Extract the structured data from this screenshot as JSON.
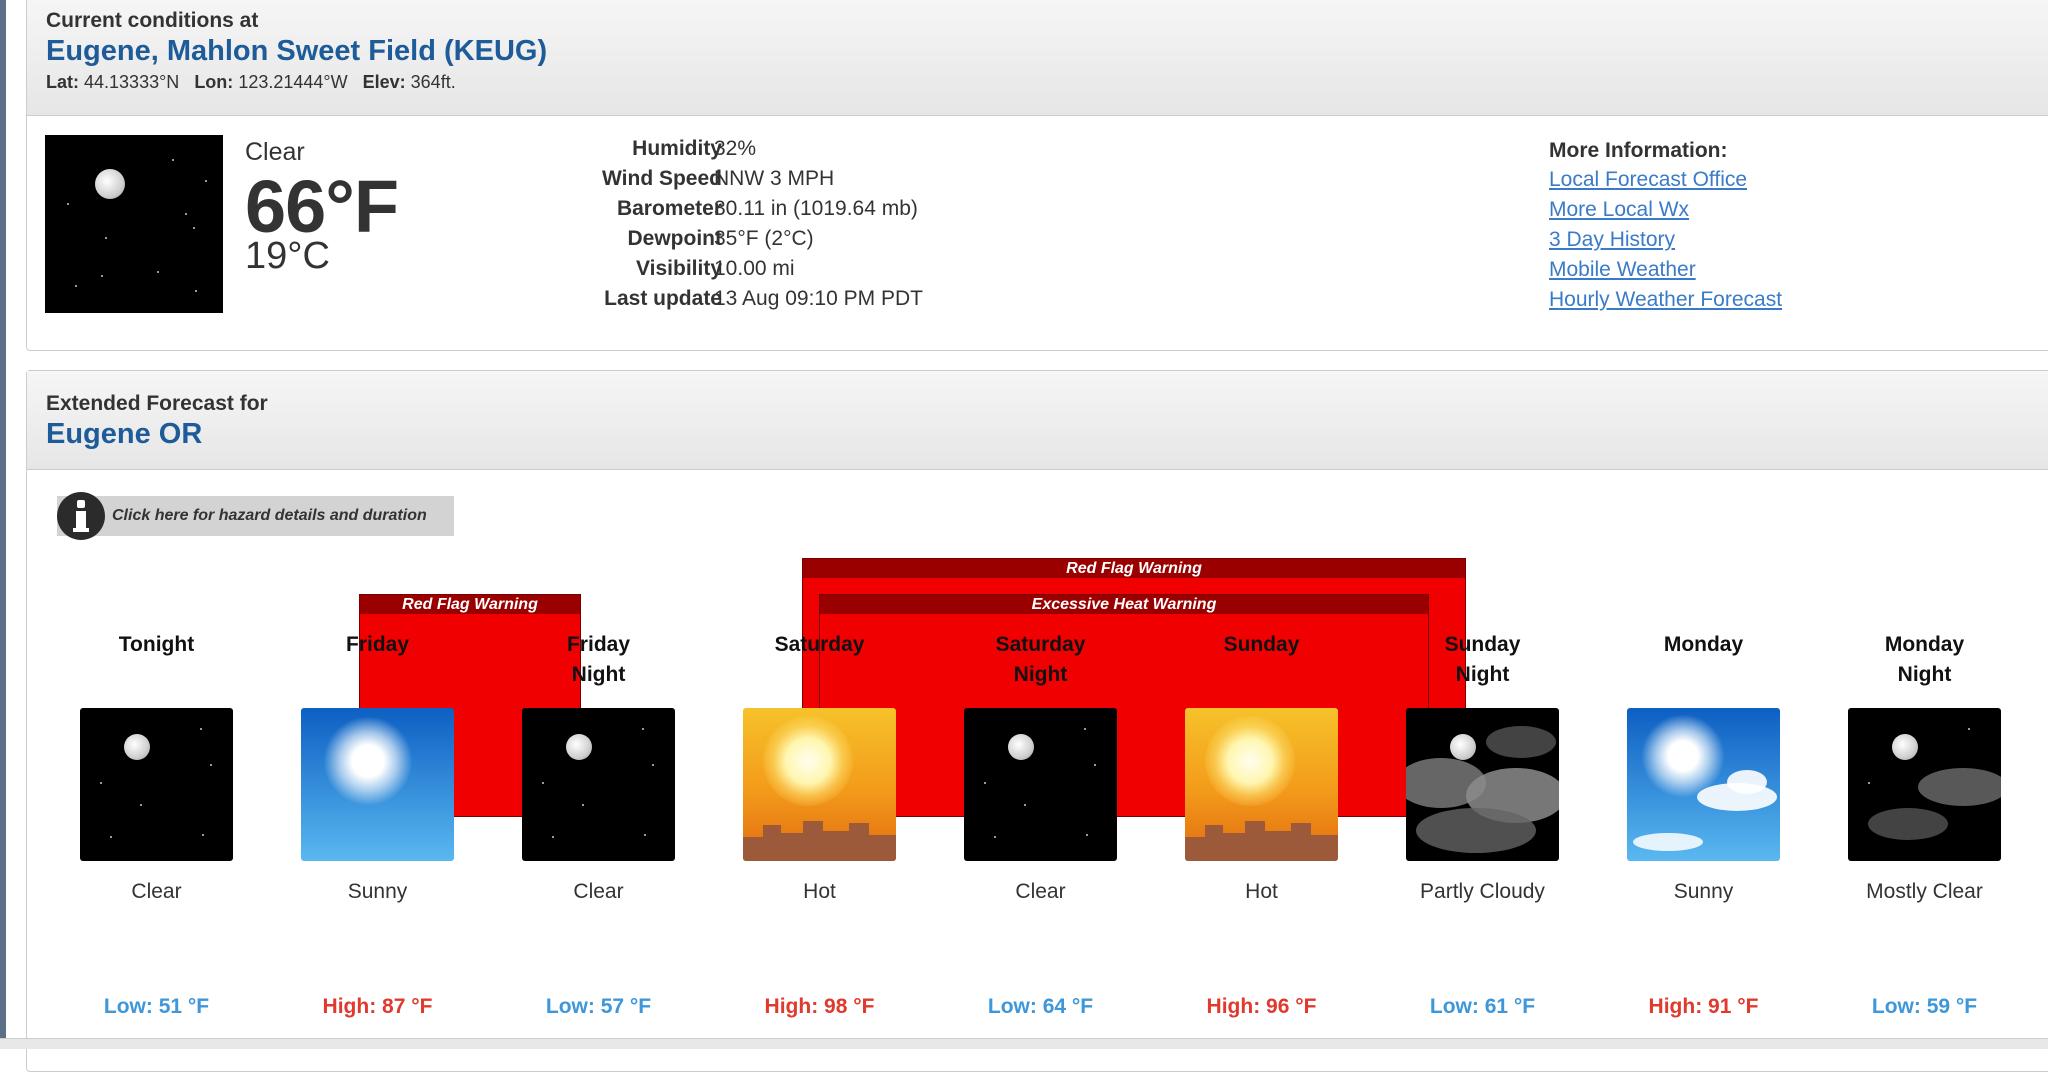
{
  "current": {
    "header_small": "Current conditions at",
    "station": "Eugene, Mahlon Sweet Field (KEUG)",
    "lat_label": "Lat:",
    "lat": "44.13333°N",
    "lon_label": "Lon:",
    "lon": "123.21444°W",
    "elev_label": "Elev:",
    "elev": "364ft.",
    "condition": "Clear",
    "temp_f": "66°F",
    "temp_c": "19°C",
    "details": [
      {
        "label": "Humidity",
        "value": "32%"
      },
      {
        "label": "Wind Speed",
        "value": "NNW 3 MPH"
      },
      {
        "label": "Barometer",
        "value": "30.11 in (1019.64 mb)"
      },
      {
        "label": "Dewpoint",
        "value": "35°F (2°C)"
      },
      {
        "label": "Visibility",
        "value": "10.00 mi"
      },
      {
        "label": "Last update",
        "value": "13 Aug 09:10 PM PDT"
      }
    ],
    "more_info_title": "More Information:",
    "more_links": [
      "Local Forecast Office",
      "More Local Wx",
      "3 Day History",
      "Mobile Weather",
      "Hourly Weather Forecast"
    ]
  },
  "extended": {
    "header_small": "Extended Forecast for",
    "location": "Eugene OR",
    "hazard_button": "Click here for hazard details and duration",
    "warnings": {
      "red_flag_1": "Red Flag Warning",
      "red_flag_2": "Red Flag Warning",
      "excessive_heat": "Excessive Heat Warning"
    },
    "periods": [
      {
        "name_1": "Tonight",
        "name_2": "",
        "icon": "night-clear-icon",
        "desc": "Clear",
        "temp": "Low: 51 °F",
        "kind": "low"
      },
      {
        "name_1": "Friday",
        "name_2": "",
        "icon": "sunny-icon",
        "desc": "Sunny",
        "temp": "High: 87 °F",
        "kind": "high"
      },
      {
        "name_1": "Friday",
        "name_2": "Night",
        "icon": "night-clear-icon",
        "desc": "Clear",
        "temp": "Low: 57 °F",
        "kind": "low"
      },
      {
        "name_1": "Saturday",
        "name_2": "",
        "icon": "hot-icon",
        "desc": "Hot",
        "temp": "High: 98 °F",
        "kind": "high"
      },
      {
        "name_1": "Saturday",
        "name_2": "Night",
        "icon": "night-clear-icon",
        "desc": "Clear",
        "temp": "Low: 64 °F",
        "kind": "low"
      },
      {
        "name_1": "Sunday",
        "name_2": "",
        "icon": "hot-icon",
        "desc": "Hot",
        "temp": "High: 96 °F",
        "kind": "high"
      },
      {
        "name_1": "Sunday",
        "name_2": "Night",
        "icon": "partly-cloudy-night-icon",
        "desc": "Partly Cloudy",
        "temp": "Low: 61 °F",
        "kind": "low"
      },
      {
        "name_1": "Monday",
        "name_2": "",
        "icon": "sunny-clouds-icon",
        "desc": "Sunny",
        "temp": "High: 91 °F",
        "kind": "high"
      },
      {
        "name_1": "Monday",
        "name_2": "Night",
        "icon": "mostly-clear-night-icon",
        "desc": "Mostly Clear",
        "temp": "Low: 59 °F",
        "kind": "low"
      }
    ]
  },
  "colors": {
    "link": "#3a7bc8",
    "heading": "#1e5b99",
    "low_temp": "#3d97d9",
    "high_temp": "#e0392d",
    "warning_fill": "#f00000",
    "warning_title": "#9a0000"
  }
}
